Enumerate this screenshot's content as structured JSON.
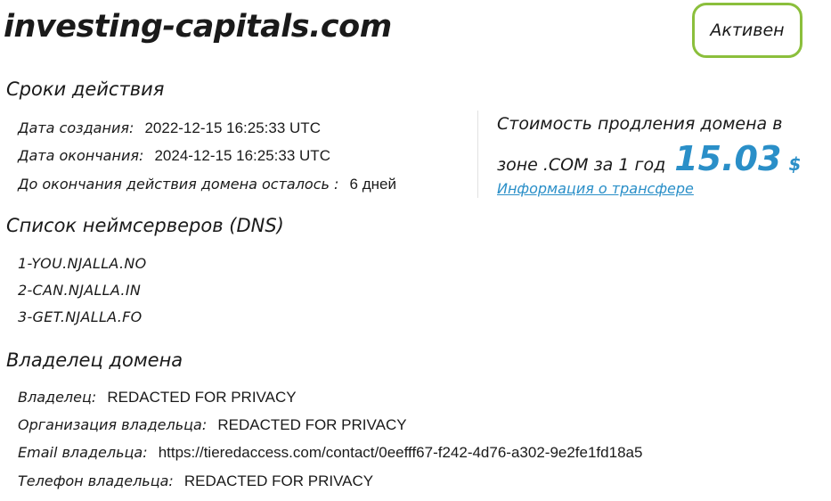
{
  "domain": {
    "name": "investing-capitals.com",
    "status": "Активен"
  },
  "validity": {
    "heading": "Сроки действия",
    "created_label": "Дата создания:",
    "created_value": "2022-12-15 16:25:33 UTC",
    "expires_label": "Дата окончания:",
    "expires_value": "2024-12-15 16:25:33 UTC",
    "remaining_label": "До окончания действия домена осталось :",
    "remaining_value": "6 дней"
  },
  "pricing": {
    "line1": "Стоимость продления домена в",
    "line2": "зоне .COM за 1 год",
    "amount": "15.03",
    "currency": "$",
    "transfer_link": "Информация о трансфере"
  },
  "nameservers": {
    "heading": "Список неймсерверов (DNS)",
    "items": [
      "1-YOU.NJALLA.NO",
      "2-CAN.NJALLA.IN",
      "3-GET.NJALLA.FO"
    ]
  },
  "owner": {
    "heading": "Владелец домена",
    "owner_label": "Владелец:",
    "owner_value": "REDACTED FOR PRIVACY",
    "org_label": "Организация владельца:",
    "org_value": "REDACTED FOR PRIVACY",
    "email_label": "Email владельца:",
    "email_value": "https://tieredaccess.com/contact/0eefff67-f242-4d76-a302-9e2fe1fd18a5",
    "phone_label": "Телефон владельца:",
    "phone_value": "REDACTED FOR PRIVACY"
  },
  "colors": {
    "accent_blue": "#2a8fc8",
    "status_green": "#8bbf3c"
  }
}
